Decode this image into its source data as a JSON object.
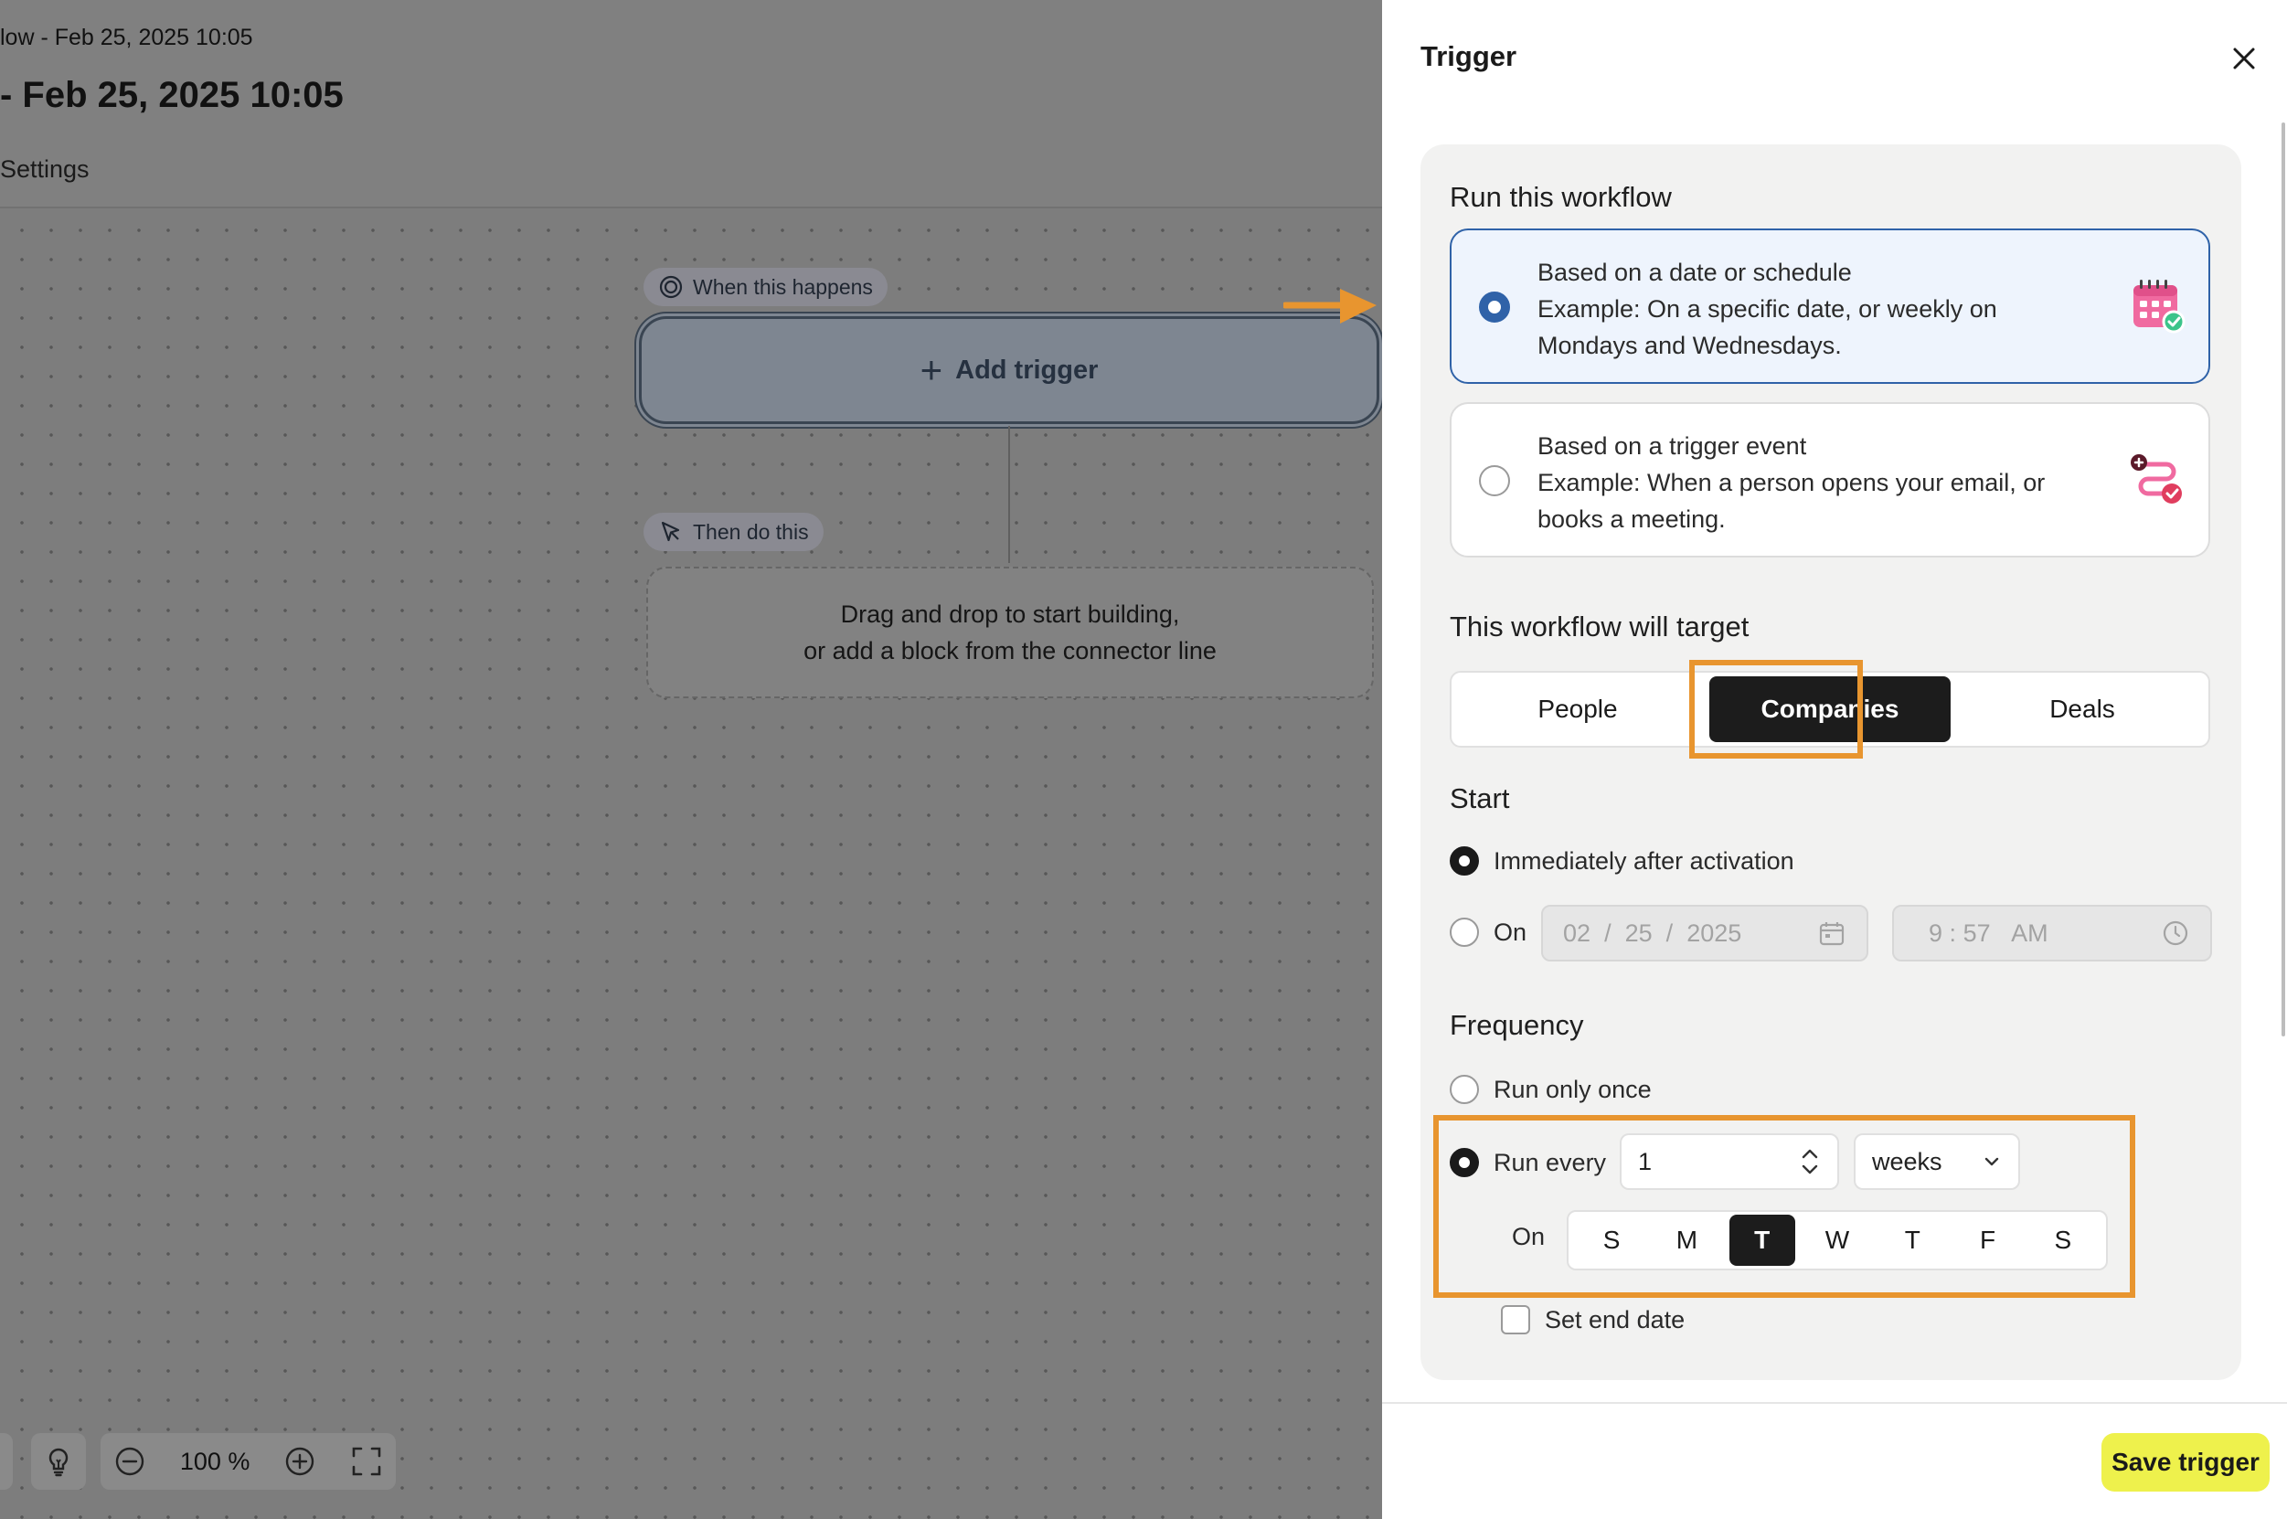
{
  "editor": {
    "breadcrumb": "low - Feb 25, 2025 10:05",
    "title": "- Feb 25, 2025 10:05",
    "tab_settings": "Settings",
    "when_label": "When this happens",
    "add_trigger_label": "Add trigger",
    "then_label": "Then do this",
    "drop_line1": "Drag and drop to start building,",
    "drop_line2": "or add a block from the connector line",
    "zoom_level": "100 %"
  },
  "panel": {
    "title": "Trigger",
    "run_section": "Run this workflow",
    "options": [
      {
        "title": "Based on a date or schedule",
        "line2": "Example: On a specific date, or weekly on",
        "line3": "Mondays and Wednesdays.",
        "selected": true,
        "icon": "calendar-icon"
      },
      {
        "title": "Based on a trigger event",
        "line2": "Example: When a person opens your email, or",
        "line3": "books a meeting.",
        "selected": false,
        "icon": "workflow-event-icon"
      }
    ],
    "target_section": "This workflow will target",
    "targets": [
      "People",
      "Companies",
      "Deals"
    ],
    "target_selected": "Companies",
    "start_section": "Start",
    "start_immediately": "Immediately after activation",
    "start_on": "On",
    "date_mm": "02",
    "date_dd": "25",
    "date_yyyy": "2025",
    "date_sep": "/",
    "time_h": "9",
    "time_sep": ":",
    "time_m": "57",
    "time_ampm": "AM",
    "frequency_section": "Frequency",
    "run_once": "Run only once",
    "run_every": "Run every",
    "interval_value": "1",
    "interval_unit": "weeks",
    "on_label": "On",
    "days": [
      "S",
      "M",
      "T",
      "W",
      "T",
      "F",
      "S"
    ],
    "days_selected_index": 2,
    "set_end_date": "Set end date",
    "save_button": "Save trigger"
  },
  "colors": {
    "highlight": "#e8952f",
    "selected_border": "#2f62a8",
    "save_button_bg": "#eef14c"
  }
}
